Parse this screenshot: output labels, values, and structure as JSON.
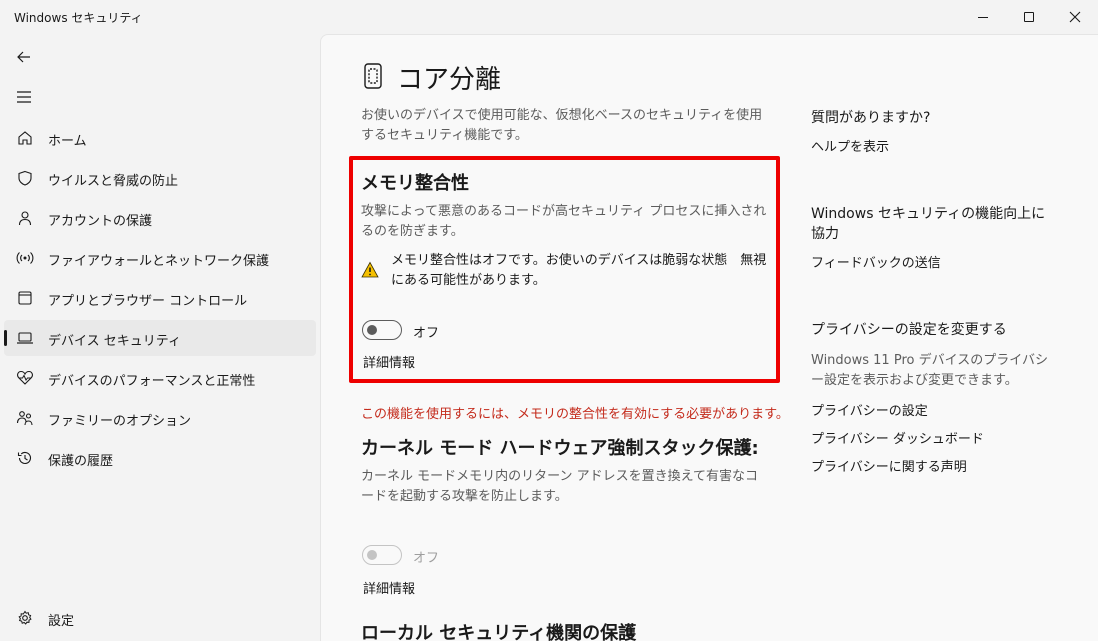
{
  "window": {
    "title": "Windows セキュリティ"
  },
  "sidebar": {
    "items": [
      {
        "label": "ホーム",
        "icon": "home-icon"
      },
      {
        "label": "ウイルスと脅威の防止",
        "icon": "shield-icon"
      },
      {
        "label": "アカウントの保護",
        "icon": "person-icon"
      },
      {
        "label": "ファイアウォールとネットワーク保護",
        "icon": "wifi-signal-icon"
      },
      {
        "label": "アプリとブラウザー コントロール",
        "icon": "app-window-icon"
      },
      {
        "label": "デバイス セキュリティ",
        "icon": "laptop-icon",
        "selected": true
      },
      {
        "label": "デバイスのパフォーマンスと正常性",
        "icon": "heart-pulse-icon"
      },
      {
        "label": "ファミリーのオプション",
        "icon": "family-icon"
      },
      {
        "label": "保護の履歴",
        "icon": "history-icon"
      }
    ],
    "settings_label": "設定"
  },
  "main": {
    "title": "コア分離",
    "description": "お使いのデバイスで使用可能な、仮想化ベースのセキュリティを使用するセキュリティ機能です。",
    "memory_integrity": {
      "heading": "メモリ整合性",
      "description": "攻撃によって悪意のあるコードが高セキュリティ プロセスに挿入されるのを防ぎます。",
      "warning": "メモリ整合性はオフです。お使いのデバイスは脆弱な状態　無視にある可能性があります。",
      "toggle_label": "オフ",
      "toggle_on": false,
      "details_link": "詳細情報"
    },
    "requirement_note": "この機能を使用するには、メモリの整合性を有効にする必要があります。",
    "kernel_stack": {
      "heading": "カーネル モード ハードウェア強制スタック保護:",
      "description": "カーネル モードメモリ内のリターン アドレスを置き換えて有害なコードを起動する攻撃を防止します。",
      "toggle_label": "オフ",
      "toggle_on": false,
      "toggle_disabled": true,
      "details_link": "詳細情報"
    },
    "lsa": {
      "heading": "ローカル セキュリティ機関の保護"
    }
  },
  "aside": {
    "question_heading": "質問がありますか?",
    "help_link": "ヘルプを表示",
    "improve_heading": "Windows セキュリティの機能向上に協力",
    "feedback_link": "フィードバックの送信",
    "privacy_heading": "プライバシーの設定を変更する",
    "privacy_description": "Windows 11 Pro デバイスのプライバシー設定を表示および変更できます。",
    "privacy_links": [
      "プライバシーの設定",
      "プライバシー ダッシュボード",
      "プライバシーに関する声明"
    ]
  },
  "colors": {
    "highlight_box": "#ee0000",
    "error_text": "#c42b1c",
    "warning_icon": "#f5c000"
  }
}
